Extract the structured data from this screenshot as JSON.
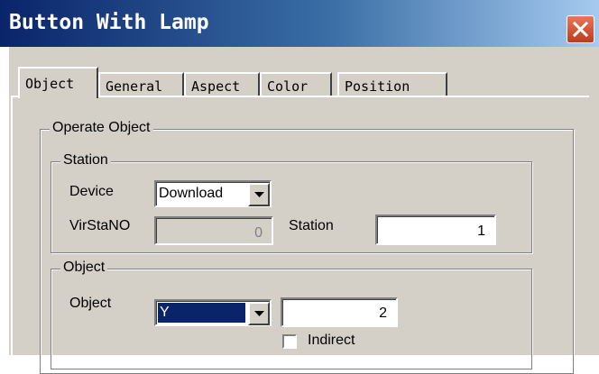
{
  "window": {
    "title": "Button With Lamp"
  },
  "tabs": [
    "Object",
    "General",
    "Aspect",
    "Color",
    "Position"
  ],
  "operate_object": {
    "title": "Operate Object",
    "station_group": {
      "title": "Station",
      "device_label": "Device",
      "device_value": "Download",
      "virstano_label": "VirStaNO",
      "virstano_value": "0",
      "station_label": "Station",
      "station_value": "1"
    },
    "object_group": {
      "title": "Object",
      "object_label": "Object",
      "object_value": "Y",
      "object_number": "2",
      "indirect_label": "Indirect"
    }
  },
  "colors": {
    "title_bar_start": "#0a246a",
    "selection": "#0a246a",
    "face": "#d4d0c8"
  }
}
